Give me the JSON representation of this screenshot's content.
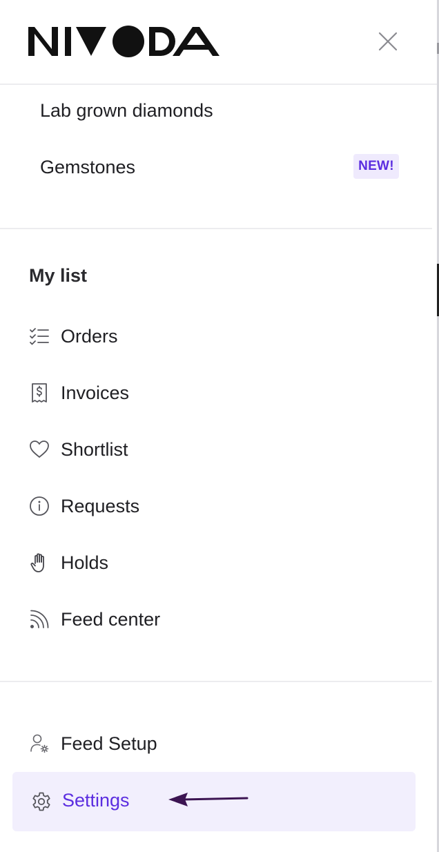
{
  "header": {
    "logo_text": "NIVODA",
    "close_icon": "close-icon"
  },
  "categories": {
    "items": [
      {
        "label": "Lab grown diamonds"
      },
      {
        "label": "Gemstones",
        "badge": "NEW!"
      }
    ]
  },
  "my_list": {
    "title": "My list",
    "items": [
      {
        "label": "Orders",
        "icon": "checklist-icon"
      },
      {
        "label": "Invoices",
        "icon": "receipt-icon"
      },
      {
        "label": "Shortlist",
        "icon": "heart-icon"
      },
      {
        "label": "Requests",
        "icon": "info-icon"
      },
      {
        "label": "Holds",
        "icon": "hand-icon"
      },
      {
        "label": "Feed center",
        "icon": "rss-icon"
      }
    ]
  },
  "account": {
    "items": [
      {
        "label": "Feed Setup",
        "icon": "user-gear-icon"
      },
      {
        "label": "Settings",
        "icon": "gear-icon",
        "active": true
      }
    ]
  },
  "colors": {
    "accent": "#5b2de0",
    "active_bg": "#f2effd",
    "badge_bg": "#efeafd",
    "arrow": "#3c1452"
  }
}
